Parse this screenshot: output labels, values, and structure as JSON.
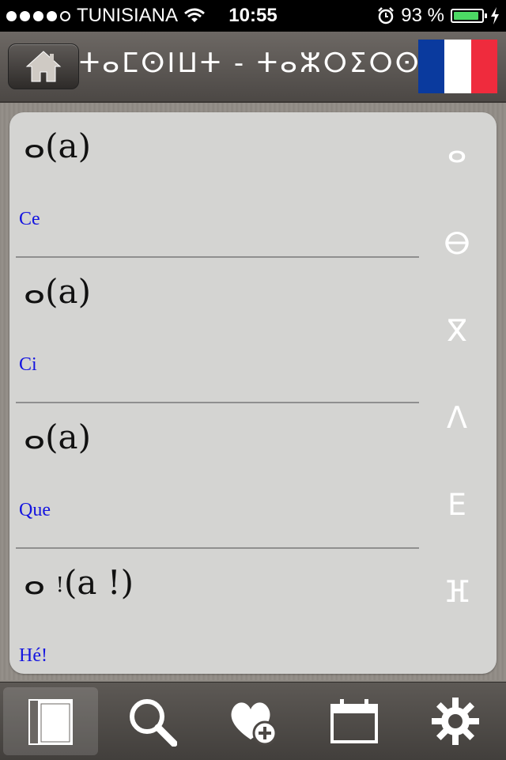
{
  "status_bar": {
    "carrier": "TUNISIANA",
    "time": "10:55",
    "battery_percent_text": "93 %",
    "battery_level": 0.93
  },
  "nav": {
    "title": "ⵜⴰⵎⵙⵏⵡⵜ ‑ ⵜⴰⵣⵔⵉⵔⵙⵔⵜ",
    "home_icon": "home-icon",
    "flag_colors": [
      "#0a3a9e",
      "#ffffff",
      "#ef2b3d"
    ]
  },
  "entries": [
    {
      "tifinagh": "ⴰ",
      "transliteration": "(a)",
      "small_mark": "",
      "french": "Ce"
    },
    {
      "tifinagh": "ⴰ",
      "transliteration": "(a)",
      "small_mark": "",
      "french": "Ci"
    },
    {
      "tifinagh": "ⴰ",
      "transliteration": "(a)",
      "small_mark": "",
      "french": "Que"
    },
    {
      "tifinagh": "ⴰ",
      "transliteration": "(a !)",
      "small_mark": "!",
      "french": "Hé!"
    }
  ],
  "index_letters": [
    "ⴰ",
    "ⴱ",
    "ⴳ",
    "ⴷ",
    "ⴹ",
    "ⴼ"
  ],
  "tabs": [
    {
      "name": "dictionary",
      "icon": "book-icon",
      "active": true
    },
    {
      "name": "search",
      "icon": "search-icon",
      "active": false
    },
    {
      "name": "favorites",
      "icon": "heart-plus-icon",
      "active": false
    },
    {
      "name": "calendar",
      "icon": "calendar-icon",
      "active": false
    },
    {
      "name": "settings",
      "icon": "gear-icon",
      "active": false
    }
  ],
  "colors": {
    "link_blue": "#1414e0",
    "card_bg": "#d4d4d2",
    "battery_green": "#4cd964"
  }
}
